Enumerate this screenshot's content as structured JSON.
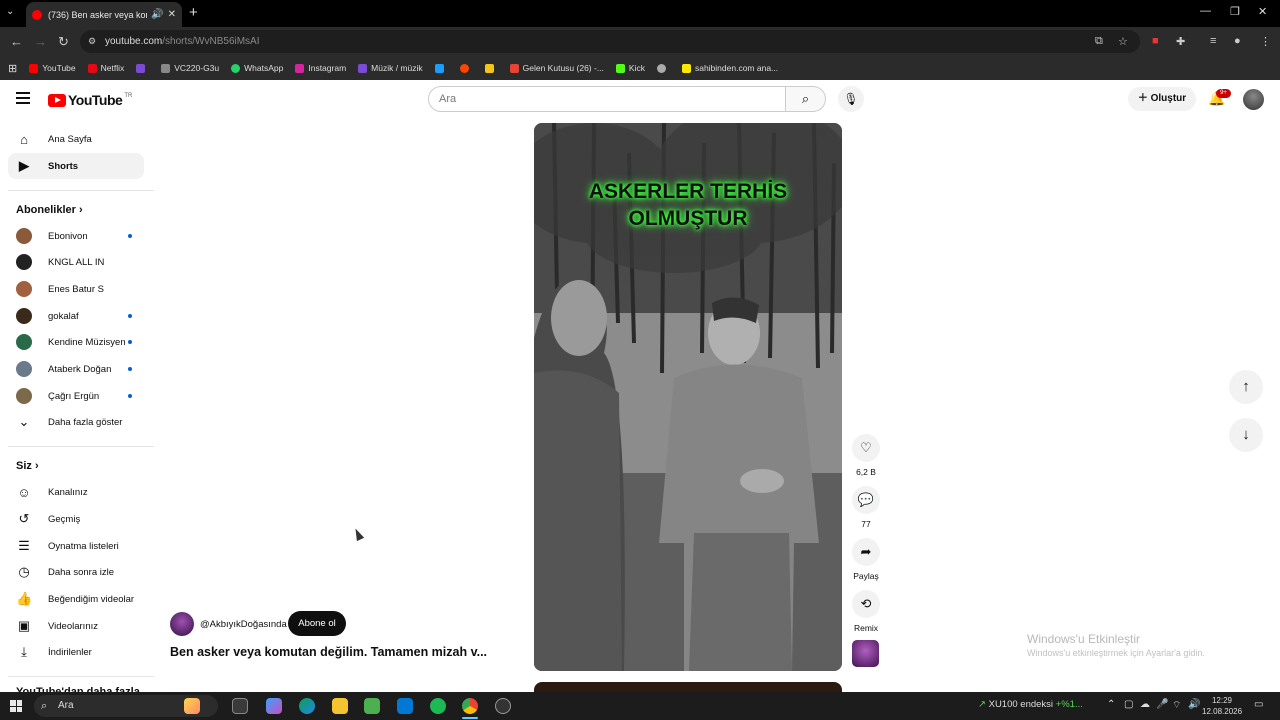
{
  "browser": {
    "tab_title": "(736) Ben asker veya komut",
    "url_host": "youtube.com",
    "url_path": "/shorts/WvNB56iMsAI",
    "bookmarks": [
      {
        "label": "YouTube",
        "color": "#ff0000"
      },
      {
        "label": "Netflix",
        "color": "#e50914"
      },
      {
        "label": "",
        "color": "#7b4bd6"
      },
      {
        "label": "VC220-G3u",
        "color": "#666666"
      },
      {
        "label": "WhatsApp",
        "color": "#25d366"
      },
      {
        "label": "Instagram",
        "color": "#d6249f"
      },
      {
        "label": "Müzik / müzik",
        "color": "#7b4bd6"
      },
      {
        "label": "",
        "color": "#1a9fff"
      },
      {
        "label": "",
        "color": "#ff4500"
      },
      {
        "label": "",
        "color": "#f5c518"
      },
      {
        "label": "Gelen Kutusu (26) -...",
        "color": "#ea4335"
      },
      {
        "label": "Kick",
        "color": "#53fc18"
      },
      {
        "label": "",
        "color": "#aaaaaa"
      },
      {
        "label": "sahibinden.com ana...",
        "color": "#ffe800"
      }
    ]
  },
  "header": {
    "logo_text": "YouTube",
    "country": "TR",
    "search_placeholder": "Ara",
    "create_label": "Oluştur",
    "notif_badge": "9+"
  },
  "sidebar": {
    "main": [
      {
        "label": "Ana Sayfa",
        "icon": "home-icon"
      },
      {
        "label": "Shorts",
        "icon": "shorts-icon"
      }
    ],
    "subs_heading": "Abonelikler",
    "subscriptions": [
      {
        "label": "Ebonivon",
        "color": "#8a5a3a",
        "new": true
      },
      {
        "label": "KNGL ALL IN",
        "color": "#222222",
        "new": false
      },
      {
        "label": "Enes Batur S",
        "color": "#a06040",
        "new": false
      },
      {
        "label": "gokalaf",
        "color": "#3a2a1a",
        "new": true
      },
      {
        "label": "Kendine Müzisyen",
        "color": "#2a6a4a",
        "new": true
      },
      {
        "label": "Ataberk Doğan",
        "color": "#6a7a8a",
        "new": true
      },
      {
        "label": "Çağrı Ergün",
        "color": "#7a6a4a",
        "new": true
      }
    ],
    "show_more": "Daha fazla göster",
    "you_heading": "Siz",
    "you": [
      {
        "label": "Kanalınız",
        "icon": "user-icon"
      },
      {
        "label": "Geçmiş",
        "icon": "history-icon"
      },
      {
        "label": "Oynatma listeleri",
        "icon": "playlist-icon"
      },
      {
        "label": "Daha sonra izle",
        "icon": "clock-icon"
      },
      {
        "label": "Beğendiğim videolar",
        "icon": "thumb-up-icon"
      },
      {
        "label": "Videolarınız",
        "icon": "video-icon"
      },
      {
        "label": "İndirilenler",
        "icon": "download-icon"
      }
    ],
    "more_heading": "YouTube'dan daha fazla"
  },
  "short": {
    "overlay_text_line1": "ASKERLER TERHİS",
    "overlay_text_line2": "OLMUŞTUR",
    "channel": "@AkbıyıkDoğasında",
    "subscribe_label": "Abone ol",
    "title": "Ben asker veya komutan değilim. Tamamen mizah v...",
    "likes": "6,2 B",
    "comments": "77",
    "share_label": "Paylaş",
    "remix_label": "Remix"
  },
  "watermark": {
    "line1": "Windows'u Etkinleştir",
    "line2": "Windows'u etkinleştirmek için Ayarlar'a gidin."
  },
  "taskbar": {
    "search_label": "Ara",
    "market_name": "XU100 endeksi",
    "market_change": "+%1...",
    "time": "12:29",
    "date": "12.08.2026"
  }
}
